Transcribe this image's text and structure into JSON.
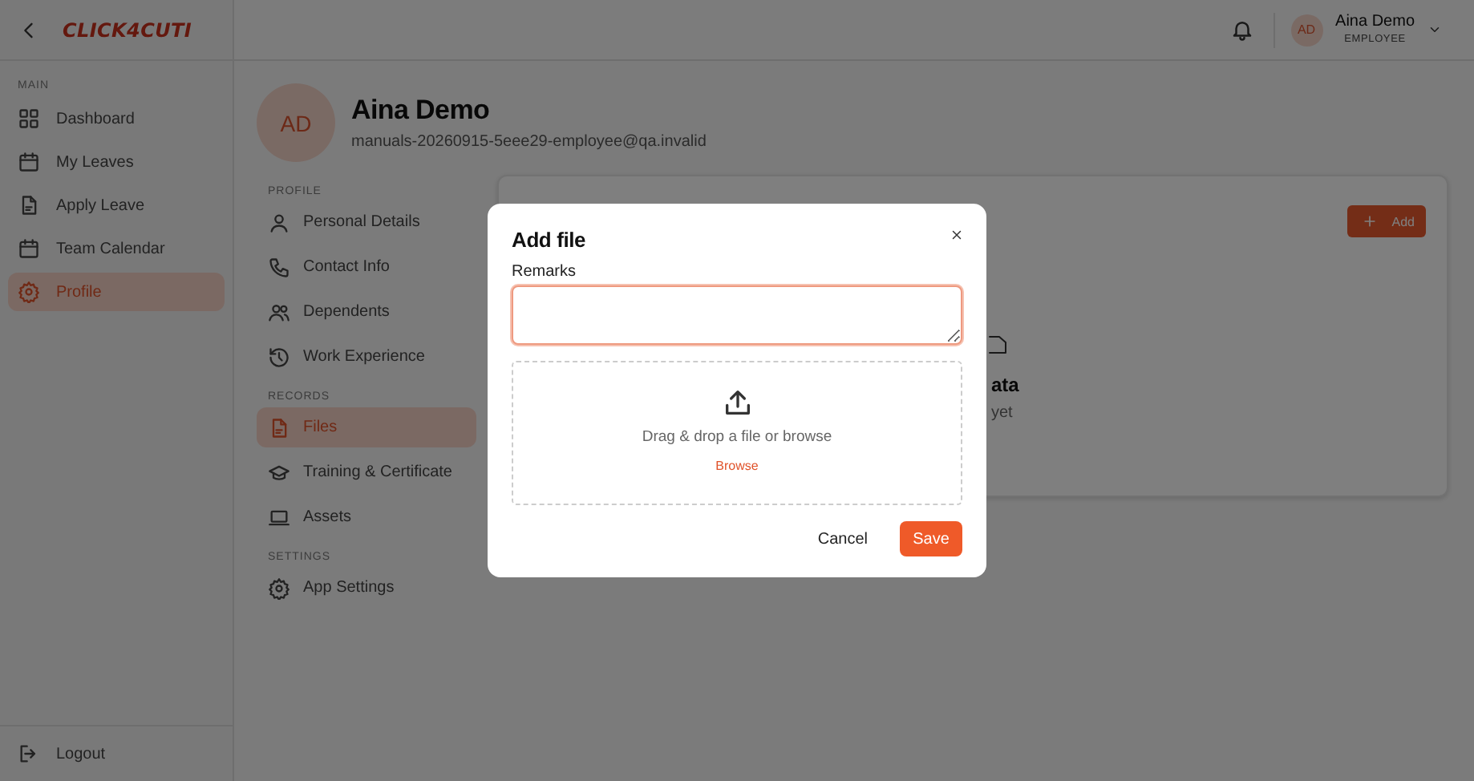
{
  "app": {
    "logo": "CLICK4CUTI"
  },
  "header": {
    "initials": "AD",
    "user_name": "Aina Demo",
    "role": "EMPLOYEE"
  },
  "sidebar": {
    "sections": [
      {
        "title": "MAIN",
        "items": [
          {
            "label": "Dashboard",
            "selected": false
          },
          {
            "label": "My Leaves",
            "selected": false
          },
          {
            "label": "Apply Leave",
            "selected": false
          },
          {
            "label": "Team Calendar",
            "selected": false
          },
          {
            "label": "Profile",
            "selected": true
          }
        ]
      }
    ],
    "logout": "Logout"
  },
  "profile": {
    "initials": "AD",
    "name": "Aina Demo",
    "email": "manuals-20260915-5eee29-employee@qa.invalid",
    "sections": [
      {
        "title": "PROFILE",
        "items": [
          {
            "label": "Personal Details",
            "selected": false
          },
          {
            "label": "Contact Info",
            "selected": false
          },
          {
            "label": "Dependents",
            "selected": false
          },
          {
            "label": "Work Experience",
            "selected": false
          }
        ]
      },
      {
        "title": "RECORDS",
        "items": [
          {
            "label": "Files",
            "selected": true
          },
          {
            "label": "Training & Certificate",
            "selected": false
          },
          {
            "label": "Assets",
            "selected": false
          }
        ]
      },
      {
        "title": "SETTINGS",
        "items": [
          {
            "label": "App Settings",
            "selected": false
          }
        ]
      }
    ]
  },
  "card": {
    "add_button": "Add",
    "empty_title": "ata",
    "empty_text": "yet"
  },
  "dialog": {
    "title": "Add file",
    "remarks_label": "Remarks",
    "remarks_focused": true,
    "dropzone_text": "Drag & drop a file or browse",
    "browse": "Browse",
    "cancel": "Cancel",
    "save": "Save"
  }
}
